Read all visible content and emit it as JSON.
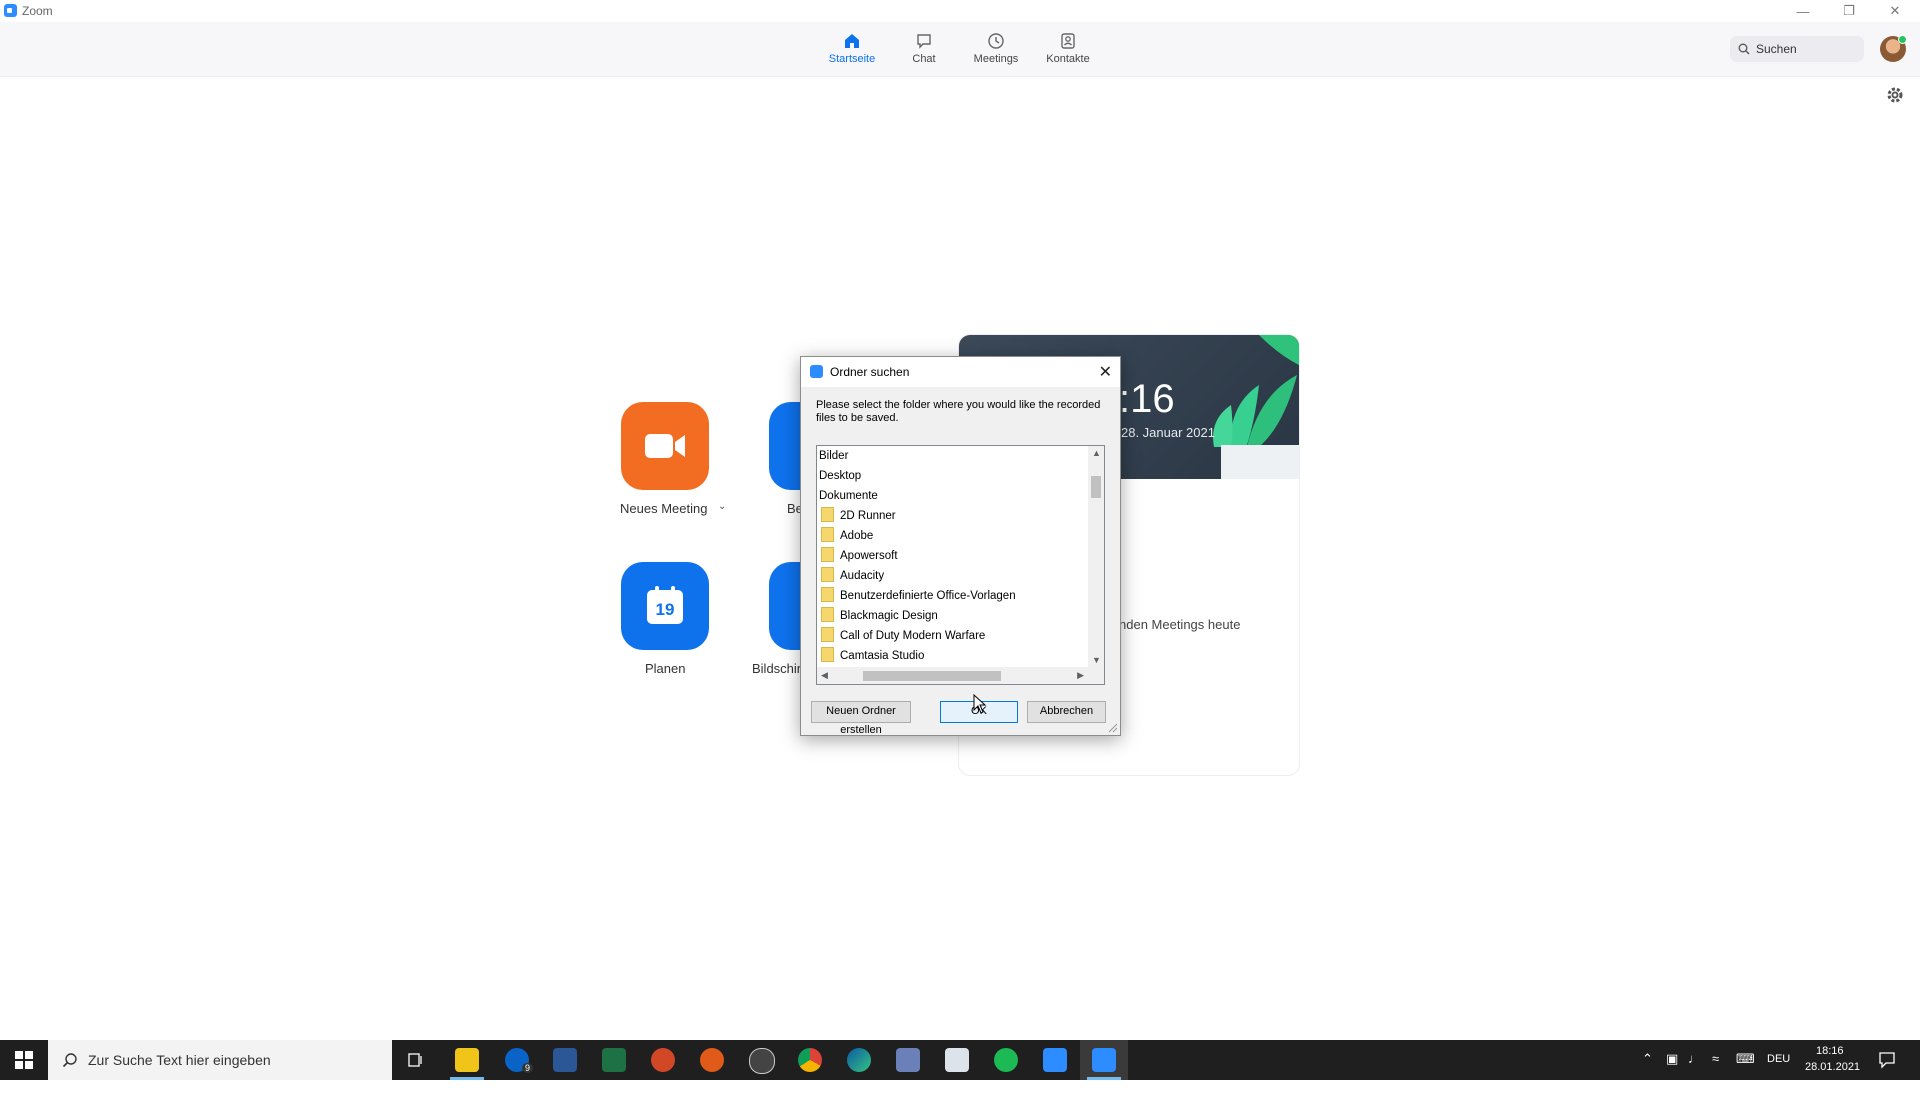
{
  "window": {
    "title": "Zoom"
  },
  "nav": {
    "items": [
      {
        "label": "Startseite",
        "icon": "home-icon",
        "active": true
      },
      {
        "label": "Chat",
        "icon": "chat-icon",
        "active": false
      },
      {
        "label": "Meetings",
        "icon": "clock-icon",
        "active": false
      },
      {
        "label": "Kontakte",
        "icon": "contacts-icon",
        "active": false
      }
    ],
    "search_label": "Suchen"
  },
  "home": {
    "tiles": [
      {
        "label": "Neues Meeting",
        "color": "#f26d21",
        "icon": "video-camera-icon"
      },
      {
        "label": "Be",
        "color": "#0e72ed",
        "icon": "plus-icon"
      },
      {
        "label": "Planen",
        "color": "#0e72ed",
        "icon": "calendar-icon",
        "calendar_day": "19"
      },
      {
        "label": "Bildschir",
        "color": "#0e72ed",
        "icon": "share-screen-icon"
      }
    ],
    "card": {
      "time": ":16",
      "date": "28. Januar 2021",
      "no_meetings": "nden Meetings heute"
    }
  },
  "dialog": {
    "title": "Ordner suchen",
    "description": "Please select the folder where you would like the recorded files to be saved.",
    "tree": [
      {
        "label": "Bilder",
        "folder": false
      },
      {
        "label": "Desktop",
        "folder": false
      },
      {
        "label": "Dokumente",
        "folder": false
      },
      {
        "label": "2D Runner",
        "folder": true
      },
      {
        "label": "Adobe",
        "folder": true
      },
      {
        "label": "Apowersoft",
        "folder": true
      },
      {
        "label": "Audacity",
        "folder": true
      },
      {
        "label": "Benutzerdefinierte Office-Vorlagen",
        "folder": true
      },
      {
        "label": "Blackmagic Design",
        "folder": true
      },
      {
        "label": "Call of Duty Modern Warfare",
        "folder": true
      },
      {
        "label": "Camtasia Studio",
        "folder": true
      }
    ],
    "buttons": {
      "new_folder": "Neuen Ordner erstellen",
      "ok": "OK",
      "cancel": "Abbrechen"
    }
  },
  "taskbar": {
    "search_placeholder": "Zur Suche Text hier eingeben",
    "mail_badge": "9",
    "language": "DEU",
    "time": "18:16",
    "date": "28.01.2021"
  },
  "colors": {
    "accent": "#0e72ed",
    "orange": "#f26d21",
    "taskbar": "#1f1f1f"
  }
}
